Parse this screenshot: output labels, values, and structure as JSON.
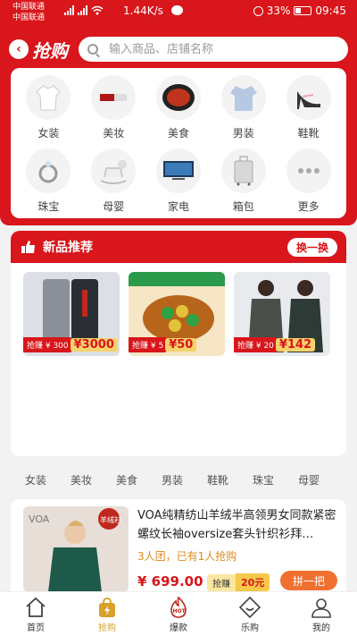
{
  "status": {
    "carrier1": "中国联通",
    "carrier2": "中国联通",
    "speed": "1.44K/s",
    "battery": "33%",
    "time": "09:45"
  },
  "header": {
    "logo": "抢购",
    "search_placeholder": "输入商品、店铺名称"
  },
  "categories": [
    {
      "label": "女装",
      "icon": "coat-icon"
    },
    {
      "label": "美妆",
      "icon": "lipstick-icon"
    },
    {
      "label": "美食",
      "icon": "crayfish-icon"
    },
    {
      "label": "男装",
      "icon": "shirt-icon"
    },
    {
      "label": "鞋靴",
      "icon": "heel-icon"
    },
    {
      "label": "珠宝",
      "icon": "ring-icon"
    },
    {
      "label": "母婴",
      "icon": "rocking-horse-icon"
    },
    {
      "label": "家电",
      "icon": "tv-icon"
    },
    {
      "label": "箱包",
      "icon": "suitcase-icon"
    },
    {
      "label": "更多",
      "icon": "more-icon"
    }
  ],
  "new_section": {
    "title": "新品推荐",
    "swap_label": "换一换",
    "products": [
      {
        "earn": "抢赚 ¥ 300",
        "price": "¥3000"
      },
      {
        "earn": "抢赚 ¥ 5",
        "price": "¥50"
      },
      {
        "earn": "抢赚 ¥ 20",
        "price": "¥142"
      }
    ]
  },
  "tabs": [
    "女装",
    "美妆",
    "美食",
    "男装",
    "鞋靴",
    "珠宝",
    "母婴"
  ],
  "product": {
    "title": "VOA纯精纺山羊绒半高领男女同款紧密螺纹长袖oversize套头针织衫拜…",
    "sold": "3人团，已有1人抢购",
    "price": "¥ 699.00",
    "earn_label": "抢赚",
    "earn_value": "20元",
    "group_button": "拼一把",
    "brand": "VOA",
    "badge": "羊绒衫"
  },
  "nav": [
    {
      "label": "首页",
      "icon": "home-icon"
    },
    {
      "label": "抢购",
      "icon": "shopping-bag-icon"
    },
    {
      "label": "爆款",
      "icon": "hot-icon"
    },
    {
      "label": "乐购",
      "icon": "smile-tag-icon"
    },
    {
      "label": "我的",
      "icon": "person-icon"
    }
  ],
  "colors": {
    "brand_red": "#d8161b",
    "active_nav": "#d7a12b"
  }
}
